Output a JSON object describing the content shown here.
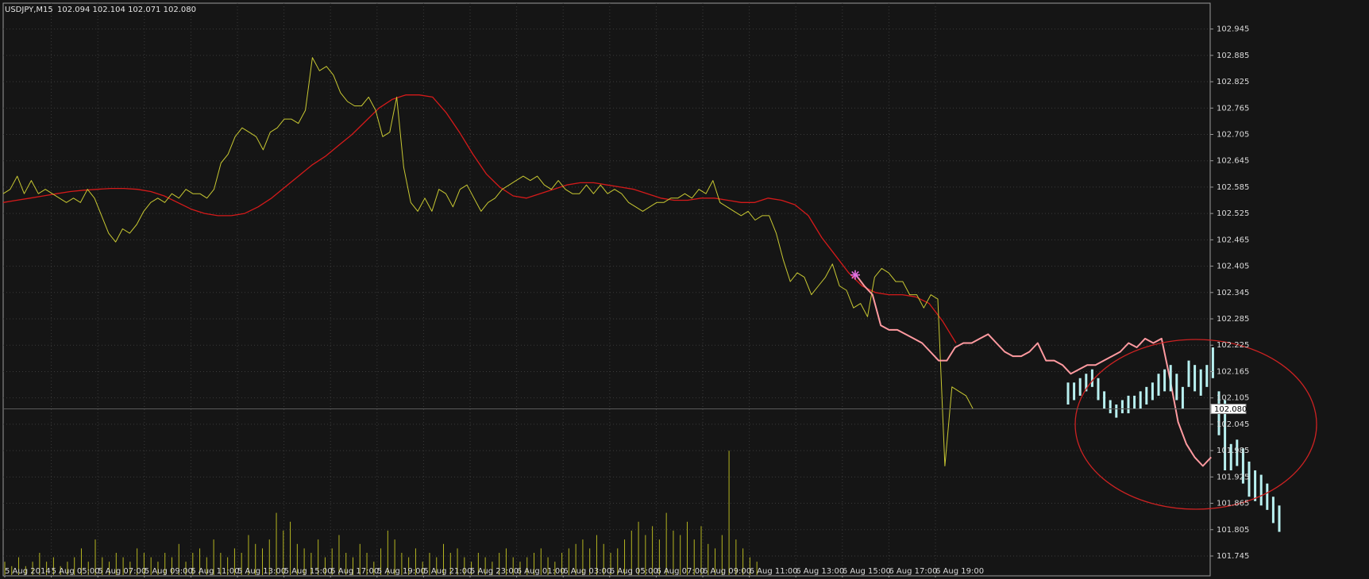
{
  "header": {
    "symbol": "USDJPY,M15",
    "ohlc": "102.094 102.104 102.071 102.080"
  },
  "chart_data": {
    "type": "line",
    "price_scale": {
      "ylim": [
        101.745,
        102.975
      ],
      "ticks": [
        "102.945",
        "102.885",
        "102.825",
        "102.765",
        "102.705",
        "102.645",
        "102.585",
        "102.525",
        "102.465",
        "102.405",
        "102.345",
        "102.285",
        "102.225",
        "102.165",
        "102.105",
        "102.045",
        "101.985",
        "101.925",
        "101.865",
        "101.805",
        "101.745"
      ],
      "current_price_label": "102.080",
      "current_price": 102.08
    },
    "time_labels": [
      "5 Aug 2014",
      "5 Aug 05:00",
      "5 Aug 07:00",
      "5 Aug 09:00",
      "5 Aug 11:00",
      "5 Aug 13:00",
      "5 Aug 15:00",
      "5 Aug 17:00",
      "5 Aug 19:00",
      "5 Aug 21:00",
      "5 Aug 23:00",
      "6 Aug 01:00",
      "6 Aug 03:00",
      "6 Aug 05:00",
      "6 Aug 07:00",
      "6 Aug 09:00",
      "6 Aug 11:00",
      "6 Aug 13:00",
      "6 Aug 15:00",
      "6 Aug 17:00",
      "6 Aug 19:00"
    ],
    "grid": true,
    "colors": {
      "background": "#151515",
      "grid": "#3a3a3a",
      "price": "#c8c832",
      "moving_average": "#d41a1a",
      "forecast": "#ff9aa0",
      "forecast_bars": "#b8f0f0",
      "volume": "#b5b520",
      "annotation_circle": "#cc2222",
      "marker": "#e070e0",
      "axis_text": "#d9d9d9"
    },
    "series": [
      {
        "key": "price",
        "values": [
          102.57,
          102.58,
          102.61,
          102.57,
          102.6,
          102.57,
          102.58,
          102.57,
          102.56,
          102.55,
          102.56,
          102.55,
          102.58,
          102.56,
          102.52,
          102.48,
          102.46,
          102.49,
          102.48,
          102.5,
          102.53,
          102.55,
          102.56,
          102.55,
          102.57,
          102.56,
          102.58,
          102.57,
          102.57,
          102.56,
          102.58,
          102.64,
          102.66,
          102.7,
          102.72,
          102.71,
          102.7,
          102.67,
          102.71,
          102.72,
          102.74,
          102.74,
          102.73,
          102.76,
          102.88,
          102.85,
          102.86,
          102.84,
          102.8,
          102.78,
          102.77,
          102.77,
          102.79,
          102.76,
          102.7,
          102.71,
          102.79,
          102.63,
          102.55,
          102.53,
          102.56,
          102.53,
          102.58,
          102.57,
          102.54,
          102.58,
          102.59,
          102.56,
          102.53,
          102.55,
          102.56,
          102.58,
          102.59,
          102.6,
          102.61,
          102.6,
          102.61,
          102.59,
          102.58,
          102.6,
          102.58,
          102.57,
          102.57,
          102.59,
          102.57,
          102.59,
          102.57,
          102.58,
          102.57,
          102.55,
          102.54,
          102.53,
          102.54,
          102.55,
          102.55,
          102.56,
          102.56,
          102.57,
          102.56,
          102.58,
          102.57,
          102.6,
          102.55,
          102.54,
          102.53,
          102.52,
          102.53,
          102.51,
          102.52,
          102.52,
          102.48,
          102.42,
          102.37,
          102.39,
          102.38,
          102.34,
          102.36,
          102.38,
          102.41,
          102.36,
          102.35,
          102.31,
          102.32,
          102.29,
          102.38,
          102.4,
          102.39,
          102.37,
          102.37,
          102.34,
          102.34,
          102.31,
          102.34,
          102.33,
          101.95,
          102.13,
          102.12,
          102.11,
          102.08
        ]
      },
      {
        "key": "moving_average",
        "values": [
          102.55,
          102.555,
          102.56,
          102.565,
          102.57,
          102.575,
          102.578,
          102.58,
          102.582,
          102.582,
          102.58,
          102.575,
          102.565,
          102.55,
          102.535,
          102.525,
          102.52,
          102.52,
          102.525,
          102.54,
          102.56,
          102.585,
          102.61,
          102.635,
          102.655,
          102.68,
          102.705,
          102.735,
          102.765,
          102.785,
          102.795,
          102.795,
          102.79,
          102.755,
          102.71,
          102.66,
          102.615,
          102.585,
          102.565,
          102.56,
          102.57,
          102.58,
          102.59,
          102.595,
          102.595,
          102.59,
          102.585,
          102.58,
          102.57,
          102.56,
          102.555,
          102.555,
          102.56,
          102.56,
          102.555,
          102.55,
          102.55,
          102.56,
          102.555,
          102.545,
          102.52,
          102.47,
          102.43,
          102.39,
          102.36,
          102.345,
          102.34,
          102.34,
          102.335,
          102.32,
          102.28,
          102.23
        ]
      },
      {
        "key": "forecast",
        "values": [
          102.385,
          102.36,
          102.34,
          102.27,
          102.26,
          102.26,
          102.25,
          102.24,
          102.23,
          102.21,
          102.19,
          102.19,
          102.22,
          102.23,
          102.23,
          102.24,
          102.25,
          102.23,
          102.21,
          102.2,
          102.2,
          102.21,
          102.23,
          102.19,
          102.19,
          102.18,
          102.16,
          102.17,
          102.18,
          102.18,
          102.19,
          102.2,
          102.21,
          102.23,
          102.22,
          102.24,
          102.23,
          102.24,
          102.15,
          102.05,
          102.0,
          101.97,
          101.95,
          101.97
        ]
      },
      {
        "key": "forecast_bars",
        "values": [
          [
            102.14,
            102.09
          ],
          [
            102.14,
            102.1
          ],
          [
            102.15,
            102.11
          ],
          [
            102.16,
            102.12
          ],
          [
            102.17,
            102.13
          ],
          [
            102.15,
            102.1
          ],
          [
            102.12,
            102.08
          ],
          [
            102.1,
            102.07
          ],
          [
            102.09,
            102.06
          ],
          [
            102.1,
            102.07
          ],
          [
            102.11,
            102.07
          ],
          [
            102.11,
            102.08
          ],
          [
            102.12,
            102.08
          ],
          [
            102.13,
            102.09
          ],
          [
            102.14,
            102.1
          ],
          [
            102.16,
            102.11
          ],
          [
            102.17,
            102.12
          ],
          [
            102.18,
            102.12
          ],
          [
            102.16,
            102.1
          ],
          [
            102.13,
            102.08
          ],
          [
            102.19,
            102.13
          ],
          [
            102.18,
            102.12
          ],
          [
            102.17,
            102.11
          ],
          [
            102.18,
            102.13
          ],
          [
            102.22,
            102.15
          ],
          [
            102.12,
            102.02
          ],
          [
            102.1,
            101.94
          ],
          [
            102.0,
            101.94
          ],
          [
            102.01,
            101.95
          ],
          [
            101.99,
            101.91
          ],
          [
            101.96,
            101.88
          ],
          [
            101.94,
            101.87
          ],
          [
            101.93,
            101.86
          ],
          [
            101.91,
            101.85
          ],
          [
            101.88,
            101.82
          ],
          [
            101.86,
            101.8
          ]
        ]
      },
      {
        "key": "volume",
        "values": [
          3,
          2,
          4,
          2,
          3,
          5,
          3,
          4,
          2,
          3,
          4,
          6,
          3,
          8,
          4,
          3,
          5,
          4,
          3,
          6,
          5,
          4,
          3,
          5,
          4,
          7,
          3,
          5,
          6,
          4,
          8,
          5,
          4,
          6,
          5,
          9,
          7,
          6,
          8,
          14,
          10,
          12,
          7,
          6,
          5,
          8,
          4,
          6,
          9,
          5,
          4,
          7,
          5,
          3,
          6,
          10,
          8,
          5,
          4,
          6,
          3,
          5,
          4,
          7,
          5,
          6,
          4,
          3,
          5,
          4,
          3,
          5,
          6,
          4,
          3,
          4,
          5,
          6,
          4,
          3,
          5,
          6,
          7,
          8,
          6,
          9,
          7,
          5,
          6,
          8,
          10,
          12,
          9,
          11,
          8,
          14,
          10,
          9,
          12,
          8,
          11,
          7,
          6,
          9,
          28,
          8,
          6,
          4,
          3
        ]
      }
    ]
  }
}
